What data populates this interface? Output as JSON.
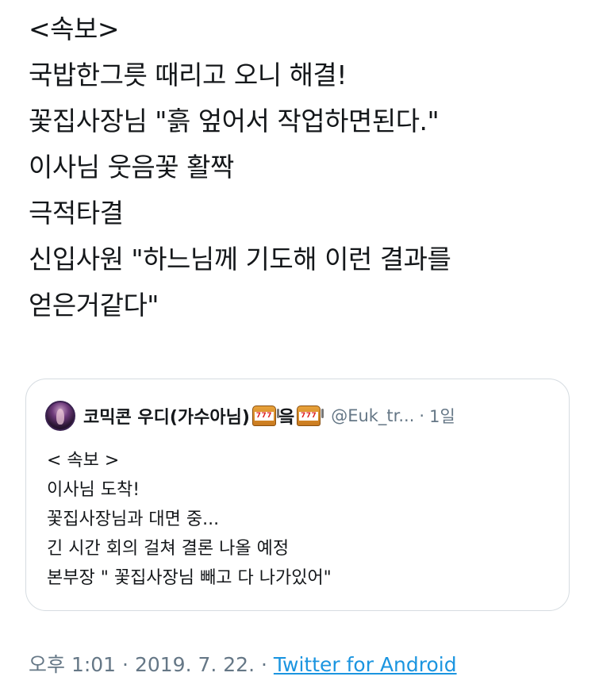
{
  "tweet": {
    "lines": [
      "<속보>",
      "국밥한그릇 때리고 오니 해결!",
      "꽃집사장님 \"흙 엎어서 작업하면된다.\"",
      "이사님 웃음꽃 활짝",
      "극적타결",
      "신입사원 \"하느님께 기도해 이런 결과를",
      "얻은거같다\""
    ]
  },
  "quoted_tweet": {
    "avatar_icon": "avatar",
    "display_name_part1": "코믹콘 우디(가수아님)",
    "name_icon_1": "slot-machine-icon",
    "display_name_part2": "읔",
    "name_icon_2": "slot-machine-icon",
    "handle": "@Euk_tr...",
    "separator": "·",
    "time_ago": "1일",
    "lines": [
      "< 속보 >",
      "이사님 도착!",
      "꽃집사장님과 대면 중...",
      "긴 시간 회의 걸쳐 결론 나올 예정",
      "본부장 \" 꽃집사장님 빼고 다 나가있어\""
    ]
  },
  "meta": {
    "time": "오후 1:01",
    "separator": "·",
    "date": "2019. 7. 22.",
    "separator2": "·",
    "source": "Twitter for Android"
  },
  "colors": {
    "text": "#14171a",
    "secondary": "#657786",
    "link": "#1b95e0",
    "border": "#d6dce1"
  }
}
